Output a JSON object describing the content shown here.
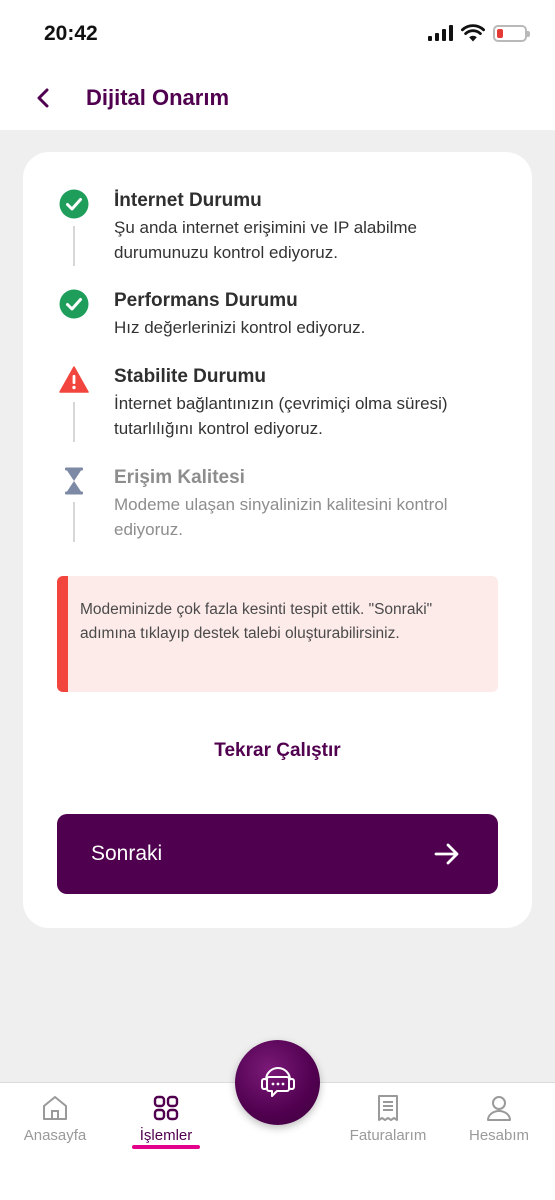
{
  "status_bar": {
    "time": "20:42"
  },
  "header": {
    "title": "Dijital Onarım"
  },
  "steps": [
    {
      "status": "success",
      "title": "İnternet Durumu",
      "description": "Şu anda internet erişimini ve IP alabilme durumunuzu kontrol ediyoruz."
    },
    {
      "status": "success",
      "title": "Performans Durumu",
      "description": "Hız değerlerinizi kontrol ediyoruz."
    },
    {
      "status": "warning",
      "title": "Stabilite Durumu",
      "description": "İnternet bağlantınızın (çevrimiçi olma süresi) tutarlılığını kontrol ediyoruz."
    },
    {
      "status": "pending",
      "title": "Erişim Kalitesi",
      "description": "Modeme ulaşan sinyalinizin kalitesini kontrol ediyoruz."
    }
  ],
  "alert": {
    "message": "Modeminizde çok fazla kesinti tespit ettik. \"Sonraki\" adımına tıklayıp destek talebi oluşturabilirsiniz."
  },
  "actions": {
    "retry_label": "Tekrar Çalıştır",
    "next_label": "Sonraki"
  },
  "bottom_nav": {
    "items": [
      {
        "label": "Anasayfa",
        "icon": "home-icon",
        "active": false
      },
      {
        "label": "İşlemler",
        "icon": "grid-icon",
        "active": true
      },
      {
        "label": "Faturalarım",
        "icon": "invoice-icon",
        "active": false
      },
      {
        "label": "Hesabım",
        "icon": "person-icon",
        "active": false
      }
    ]
  },
  "colors": {
    "brand": "#50004f",
    "success": "#1e9e5a",
    "warning": "#f2453d",
    "pending": "#7d8aa6",
    "nav_active_underline": "#e4008a"
  }
}
